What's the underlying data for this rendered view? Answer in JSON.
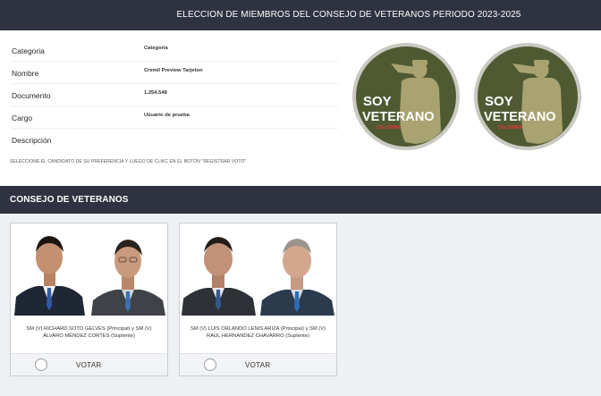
{
  "header": {
    "title": "ELECCION DE MIEMBROS DEL CONSEJO DE VETERANOS PERIODO 2023-2025"
  },
  "info": {
    "rows": [
      {
        "label": "Categoria",
        "value": "Categoria"
      },
      {
        "label": "Nombre",
        "value": "Cremil Preview Tarjeton"
      },
      {
        "label": "Documento",
        "value": "1.254.548"
      },
      {
        "label": "Cargo",
        "value": "Usuario de prueba"
      },
      {
        "label": "Descripción",
        "value": ""
      }
    ],
    "instructions": "SELECCIONE EL CANDIDATO DE SU PREFERENCIA Y LUEGO DE CLIKC EN EL BOTÓN \"REGISTRAR VOTO\""
  },
  "logo": {
    "line1": "SOY",
    "line2": "VETERANO",
    "line3": "COLOMBIA",
    "colors": {
      "bg": "#4f5a33",
      "ring": "#c9c9c1",
      "silhouette": "#a8a370",
      "text": "#ffffff",
      "accent": "#e2363f"
    }
  },
  "section": {
    "title": "CONSEJO DE VETERANOS"
  },
  "candidates": [
    {
      "name": "SM (V) RICHARD SOTO GELVES (Principal) y SM (V) ÁLVARO MÉNDEZ CORTES (Suplente)",
      "vote_label": "VOTAR",
      "photos": [
        "principal-photo",
        "suplente-photo"
      ]
    },
    {
      "name": "SM (V) LUIS ORLANDO LENIS ARIZA (Principal) y SM (V) RAUL HERNANDEZ CHAVARRO (Suplente)",
      "vote_label": "VOTAR",
      "photos": [
        "principal-photo",
        "suplente-photo"
      ]
    }
  ],
  "colors": {
    "bar": "#2f3341",
    "page_bg": "#eef0f3"
  }
}
